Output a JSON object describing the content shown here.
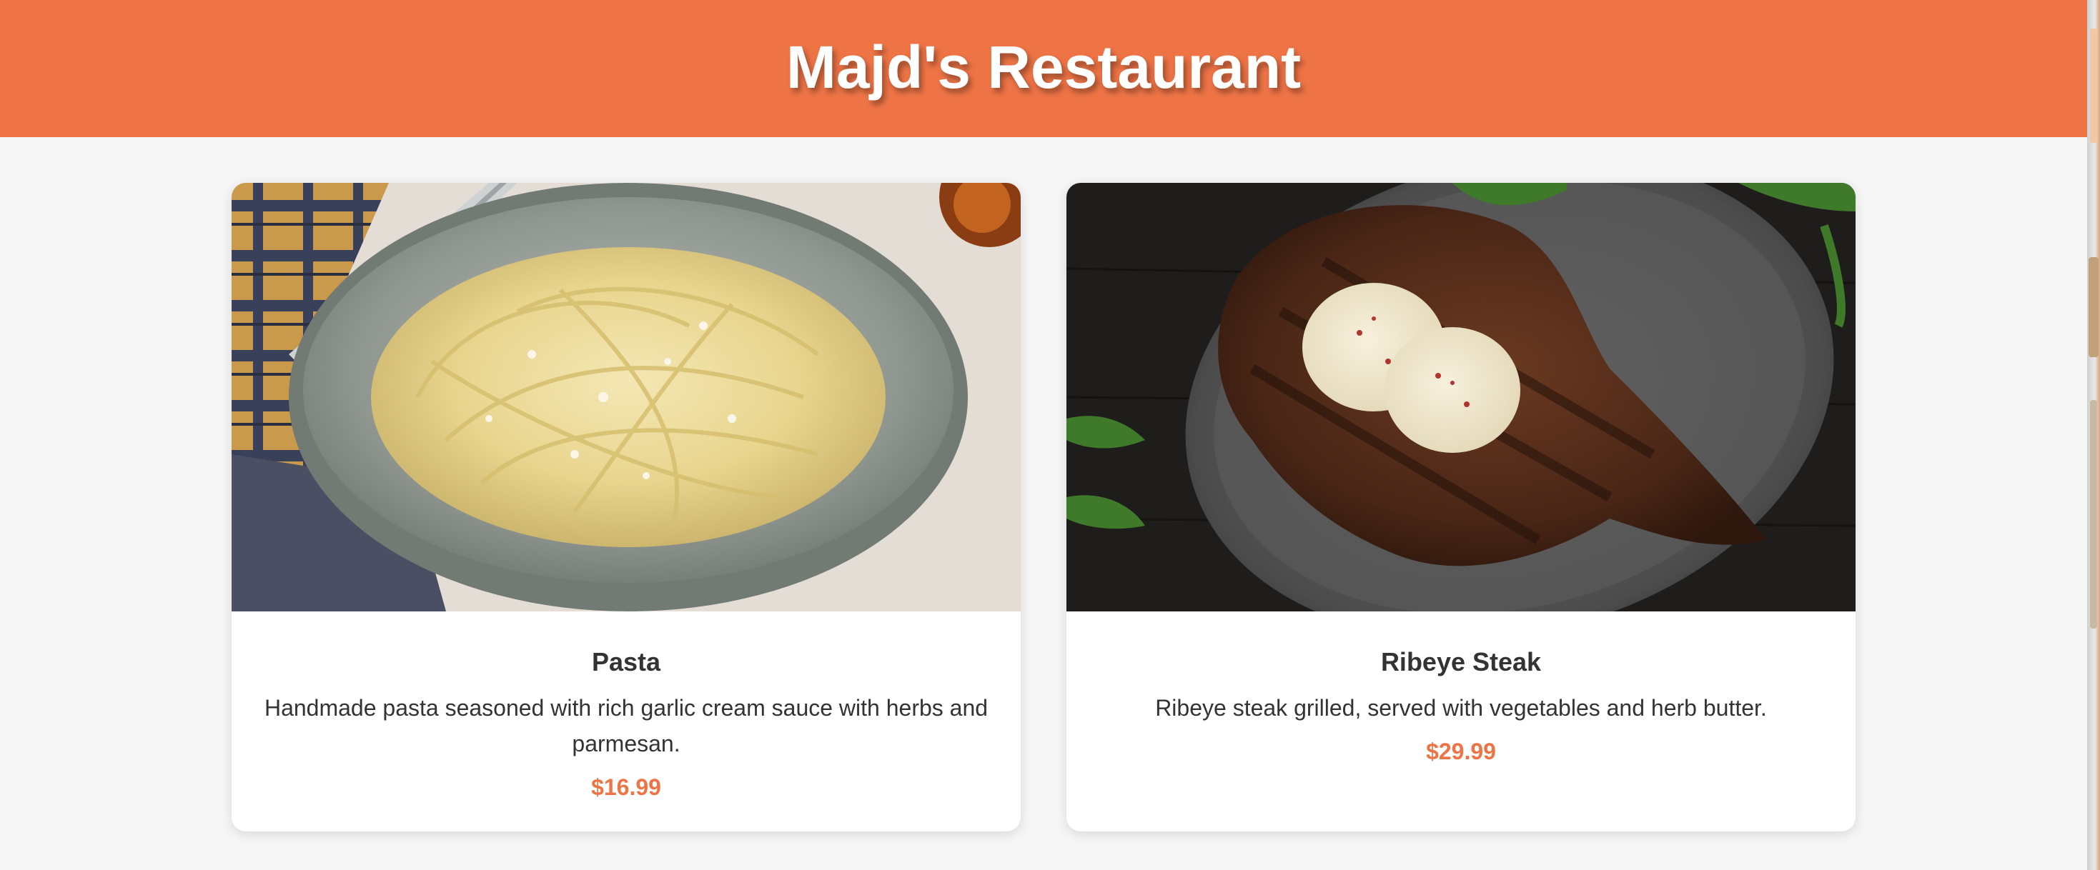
{
  "header": {
    "title": "Majd's Restaurant",
    "background_color": "#ee7446"
  },
  "menu": [
    {
      "name": "Pasta",
      "description": "Handmade pasta seasoned with rich garlic cream sauce with herbs and parmesan.",
      "price": "$16.99",
      "image_icon": "pasta-photo"
    },
    {
      "name": "Ribeye Steak",
      "description": "Ribeye steak grilled, served with vegetables and herb butter.",
      "price": "$29.99",
      "image_icon": "steak-photo"
    }
  ],
  "colors": {
    "accent": "#ee7446",
    "page_background": "#f6f6f6",
    "card_background": "#ffffff",
    "text": "#333333"
  }
}
